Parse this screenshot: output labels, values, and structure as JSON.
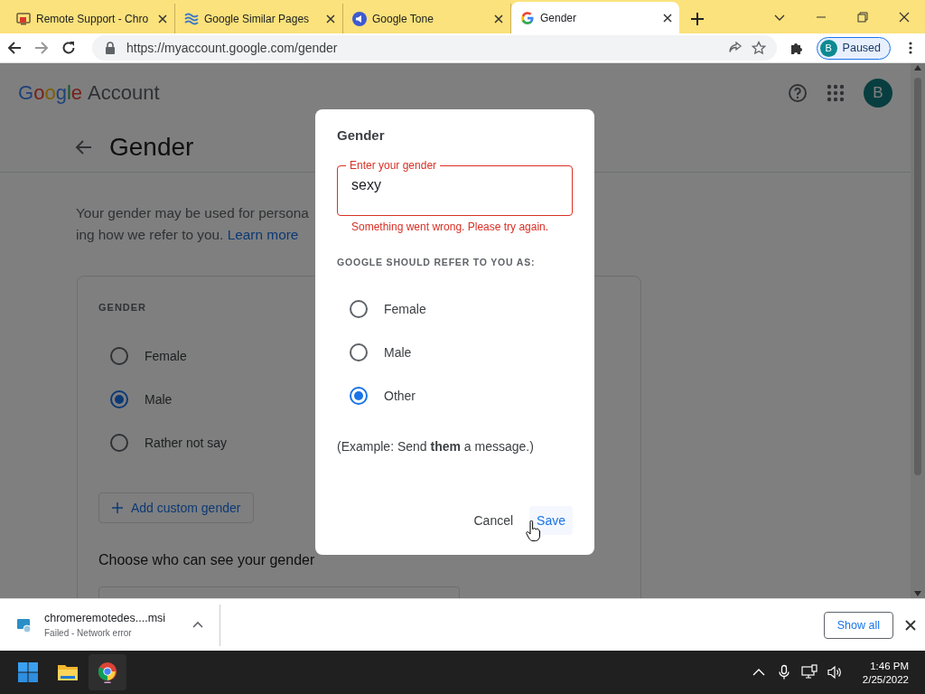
{
  "browser": {
    "tabs": [
      {
        "kind": "remote",
        "title": "Remote Support - Chro",
        "selected": false
      },
      {
        "kind": "similar",
        "title": "Google Similar Pages",
        "selected": false
      },
      {
        "kind": "tone",
        "title": "Google Tone",
        "selected": false
      },
      {
        "kind": "google",
        "title": "Gender",
        "selected": true
      }
    ],
    "address": "https://myaccount.google.com/gender",
    "profile": {
      "initial": "B",
      "label": "Paused"
    }
  },
  "page": {
    "logo": {
      "brand": "Google",
      "product": "Account"
    },
    "avatar": "B",
    "title": "Gender",
    "description": [
      "Your gender may be used for persona",
      "ing how we refer to you."
    ],
    "link": "Learn more",
    "card": {
      "heading": "GENDER",
      "options": [
        {
          "label": "Female",
          "selected": false
        },
        {
          "label": "Male",
          "selected": true
        },
        {
          "label": "Rather not say",
          "selected": false
        }
      ],
      "add_button": "Add custom gender",
      "visibility_title": "Choose who can see your gender"
    }
  },
  "dialog": {
    "title": "Gender",
    "field": {
      "label": "Enter your gender",
      "value": "sexy",
      "error": "Something went wrong. Please try again."
    },
    "heading": "GOOGLE SHOULD REFER TO YOU AS:",
    "options": [
      {
        "label": "Female",
        "selected": false
      },
      {
        "label": "Male",
        "selected": false
      },
      {
        "label": "Other",
        "selected": true
      }
    ],
    "example": "(Example: Send **them** a message.)",
    "buttons": [
      {
        "kind": "cancel",
        "label": "Cancel"
      },
      {
        "kind": "save",
        "label": "Save"
      }
    ]
  },
  "downloads": {
    "file": "chromeremotedes....msi",
    "status": "Failed - Network error",
    "show_all": "Show all"
  },
  "taskbar": {
    "time": "1:46 PM",
    "date": "2/25/2022"
  }
}
